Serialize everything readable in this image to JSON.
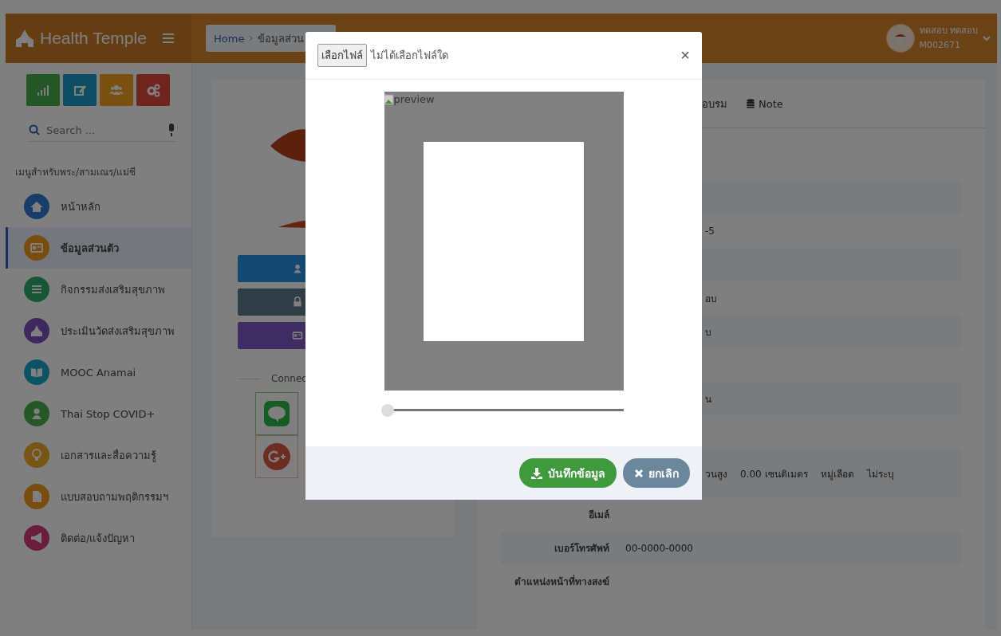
{
  "header": {
    "app_name": "Health Temple",
    "breadcrumb": [
      {
        "label": "Home"
      },
      {
        "label": "ข้อมูลส่วน"
      }
    ],
    "user": {
      "name": "ทดสอบ ทดสอบ",
      "id": "M002671"
    }
  },
  "sidebar": {
    "quick_buttons": [
      {
        "kind": "chart"
      },
      {
        "kind": "edit"
      },
      {
        "kind": "group"
      },
      {
        "kind": "gears"
      }
    ],
    "search": {
      "placeholder": "Search ..."
    },
    "section_title": "เมนูสำหรับพระ/สามเณร/แม่ชี",
    "items": [
      {
        "label": "หน้าหลัก",
        "kind": "home",
        "selected": false
      },
      {
        "label": "ข้อมูลส่วนตัว",
        "kind": "card",
        "selected": true
      },
      {
        "label": "กิจกรรมส่งเสริมสุขภาพ",
        "kind": "list",
        "selected": false
      },
      {
        "label": "ประเมินวัดส่งเสริมสุขภาพ",
        "kind": "temple",
        "selected": false
      },
      {
        "label": "MOOC Anamai",
        "kind": "book",
        "selected": false
      },
      {
        "label": "Thai Stop COVID+",
        "kind": "person",
        "selected": false
      },
      {
        "label": "เอกสารและสื่อความรู้",
        "kind": "bulb",
        "selected": false
      },
      {
        "label": "แบบสอบถามพฤติกรรมฯ",
        "kind": "file",
        "selected": false
      },
      {
        "label": "ติดต่อ/แจ้งปัญหา",
        "kind": "megaphone",
        "selected": false
      }
    ]
  },
  "profile_card": {
    "buttons": [
      {
        "kind": "user"
      },
      {
        "kind": "lock"
      },
      {
        "kind": "idcard"
      }
    ],
    "connect_label": "Connec",
    "social": [
      {
        "kind": "line"
      },
      {
        "kind": "google"
      }
    ]
  },
  "details": {
    "tabs": [
      {
        "label": "อบรม",
        "kind": "plain"
      },
      {
        "label": "Note",
        "kind": "database"
      }
    ],
    "rows": [
      {
        "values": []
      },
      {
        "values": [
          "-5"
        ]
      },
      {
        "values": []
      },
      {
        "values": [
          "อบ"
        ]
      },
      {
        "values": [
          "บ"
        ]
      },
      {
        "values": []
      },
      {
        "values": [
          "น"
        ]
      },
      {
        "values": []
      },
      {
        "values": [
          "วนสูง",
          "0.00 เซนติเมตร",
          "หมู่เลือด",
          "ไม่ระบุ"
        ]
      },
      {
        "label": "อีเมล์",
        "values": []
      },
      {
        "label": "เบอร์โทรศัพท์",
        "values": [
          "00-0000-0000"
        ]
      },
      {
        "label": "ตำแหน่งหน้าที่ทางสงฆ์",
        "values": []
      }
    ]
  },
  "modal": {
    "file_button": "เลือกไฟล์",
    "file_status": "ไม่ได้เลือกไฟล์ใด",
    "close": "×",
    "preview_alt": "preview",
    "slider": {
      "level": 0
    },
    "save_button": "บันทึกข้อมูล",
    "cancel_button": "ยกเลิก"
  }
}
